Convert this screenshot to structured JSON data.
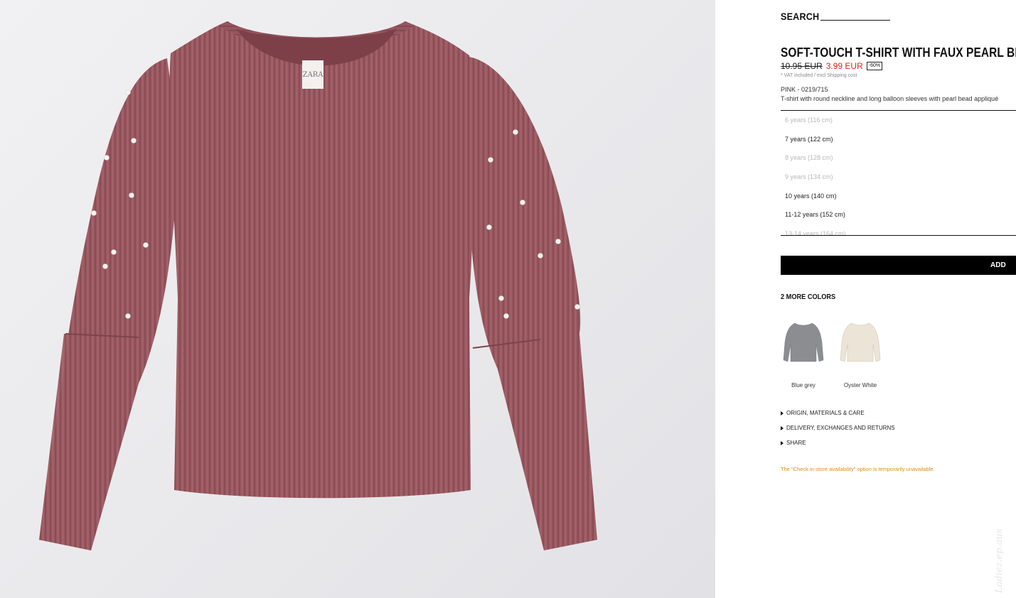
{
  "search": {
    "label": "SEARCH"
  },
  "product": {
    "title": "SOFT-TOUCH T-SHIRT WITH FAUX PEARL BEAD",
    "old_price": "10.95 EUR",
    "new_price": "3.99 EUR",
    "discount": "-60%",
    "vat_note": "* VAT included / excl Shipping cost",
    "color_ref": "PINK - 0219/715",
    "description": "T-shirt with round neckline and long balloon sleeves with pearl bead appliqué"
  },
  "sizes": [
    {
      "label": "6 years (116 cm)",
      "available": false
    },
    {
      "label": "7 years (122 cm)",
      "available": true
    },
    {
      "label": "8 years (128 cm)",
      "available": false
    },
    {
      "label": "9 years (134 cm)",
      "available": false
    },
    {
      "label": "10 years (140 cm)",
      "available": true
    },
    {
      "label": "11-12 years (152 cm)",
      "available": true
    },
    {
      "label": "13-14 years (164 cm)",
      "available": false
    }
  ],
  "add_button": {
    "label": "ADD"
  },
  "more_colors": {
    "heading": "2 MORE COLORS",
    "items": [
      {
        "label": "Blue grey",
        "color": "#8b8d90"
      },
      {
        "label": "Oyster White",
        "color": "#ece4d6"
      }
    ]
  },
  "accordion": [
    {
      "label": "ORIGIN, MATERIALS & CARE"
    },
    {
      "label": "DELIVERY, EXCHANGES AND RETURNS"
    },
    {
      "label": "SHARE"
    }
  ],
  "notice": "The \"Check in-store availability\" option is temporarily unavailable.",
  "photo": {
    "tag_text": "ZARA",
    "garment_color": "#9b5a62"
  },
  "watermark": "Ladiez.ep.aus"
}
